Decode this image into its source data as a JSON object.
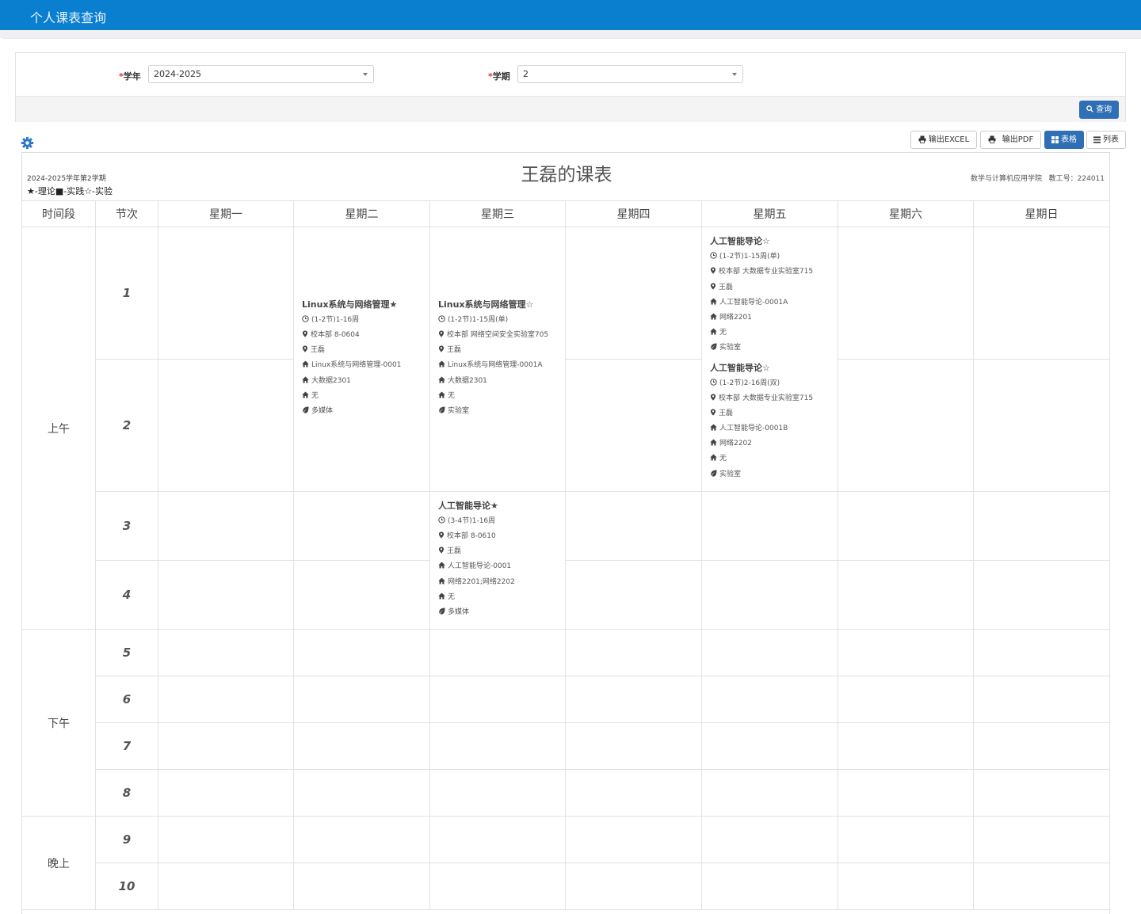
{
  "header": {
    "title": "个人课表查询"
  },
  "filter": {
    "year_label": "学年",
    "year_value": "2024-2025",
    "term_label": "学期",
    "term_value": "2",
    "query_button": "查询"
  },
  "toolbar": {
    "excel_label": "输出EXCEL",
    "pdf_label": "输出PDF",
    "table_label": "表格",
    "list_label": "列表"
  },
  "timetable": {
    "title": "王磊的课表",
    "semester": "2024-2025学年第2学期",
    "legend": "★-理论■-实践☆-实验",
    "college": "数学与计算机应用学院",
    "teacher_id": "教工号：224011",
    "headers": [
      "时间段",
      "节次",
      "星期一",
      "星期二",
      "星期三",
      "星期四",
      "星期五",
      "星期六",
      "星期日"
    ],
    "periods": [
      "上午",
      "下午",
      "晚上"
    ],
    "jieci": [
      "1",
      "2",
      "3",
      "4",
      "5",
      "6",
      "7",
      "8",
      "9",
      "10"
    ],
    "courses": {
      "tue_12": {
        "name": "Linux系统与网络管理★",
        "lines": [
          "(1-2节)1-16周",
          "校本部 8-0604",
          "王磊",
          "Linux系统与网络管理-0001",
          "大数据2301",
          "无",
          "多媒体"
        ]
      },
      "wed_12": {
        "name": "Linux系统与网络管理☆",
        "lines": [
          "(1-2节)1-15周(单)",
          "校本部 网络空间安全实验室705",
          "王磊",
          "Linux系统与网络管理-0001A",
          "大数据2301",
          "无",
          "实验室"
        ]
      },
      "fri_12a": {
        "name": "人工智能导论☆",
        "lines": [
          "(1-2节)1-15周(单)",
          "校本部 大数据专业实验室715",
          "王磊",
          "人工智能导论-0001A",
          "网络2201",
          "无",
          "实验室"
        ]
      },
      "fri_12b": {
        "name": "人工智能导论☆",
        "lines": [
          "(1-2节)2-16周(双)",
          "校本部 大数据专业实验室715",
          "王磊",
          "人工智能导论-0001B",
          "网络2202",
          "无",
          "实验室"
        ]
      },
      "wed_34": {
        "name": "人工智能导论★",
        "lines": [
          "(3-4节)1-16周",
          "校本部 8-0610",
          "王磊",
          "人工智能导论-0001",
          "网络2201;网络2202",
          "无",
          "多媒体"
        ]
      }
    }
  }
}
